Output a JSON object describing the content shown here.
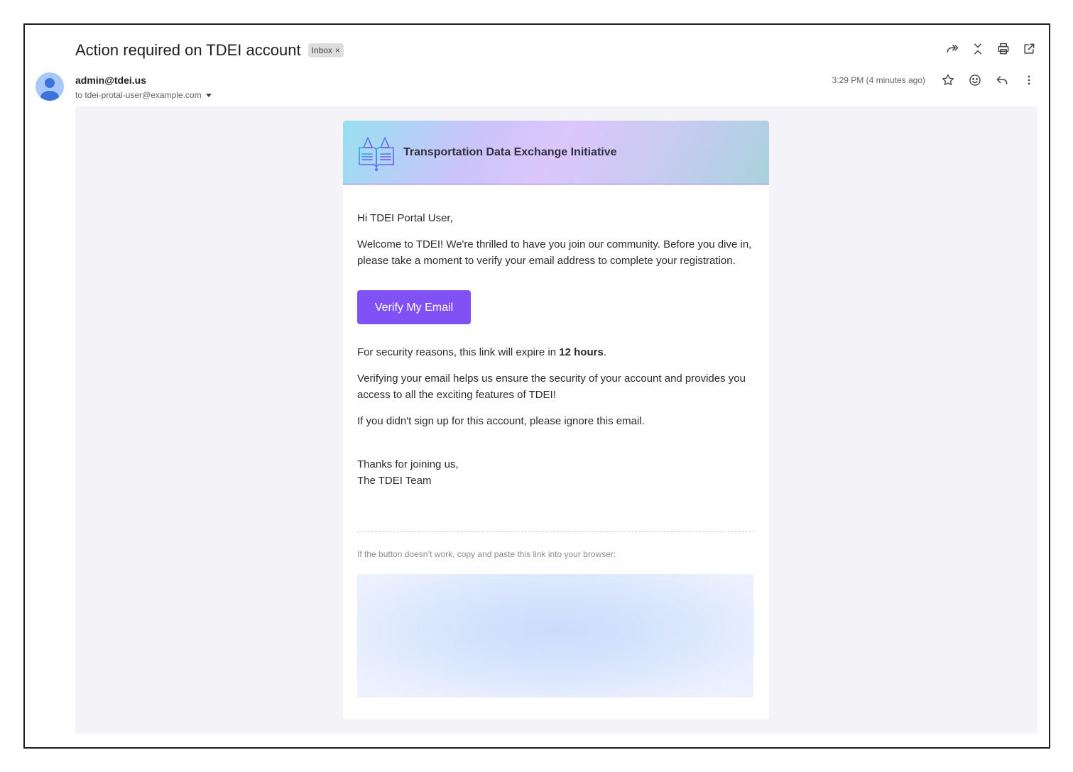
{
  "email": {
    "subject": "Action required on TDEI account",
    "label": "Inbox",
    "label_remove": "×",
    "sender": "admin@tdei.us",
    "to_line": "to tdei-protal-user@example.com",
    "timestamp": "3:29 PM (4 minutes ago)"
  },
  "toolbar": {
    "icons": [
      "forward-all-icon",
      "collapse-icon",
      "print-icon",
      "open-in-new-window-icon"
    ],
    "meta_icons": [
      "star-icon",
      "emoji-icon",
      "reply-icon",
      "more-vertical-icon"
    ]
  },
  "message": {
    "org_name": "Transportation Data Exchange Initiative",
    "greeting": "Hi TDEI Portal User,",
    "welcome": "Welcome to TDEI! We're thrilled to have you join our community. Before you dive in, please take a moment to verify your email address to complete your registration.",
    "button_label": "Verify My Email",
    "expiry_prefix": "For security reasons, this link will expire in ",
    "expiry_value": "12 hours",
    "expiry_suffix": ".",
    "benefit": "Verifying your email helps us ensure the security of your account and provides you access to all the exciting features of TDEI!",
    "ignore": "If you didn't sign up for this account, please ignore this email.",
    "thanks": "Thanks for joining us,",
    "team": "The TDEI Team",
    "fallback": "If the button doesn’t work, copy and paste this link into your browser:"
  },
  "colors": {
    "accent": "#8051f4",
    "avatar": "#a8c7fa",
    "mail_bg": "#f4f3f7"
  }
}
